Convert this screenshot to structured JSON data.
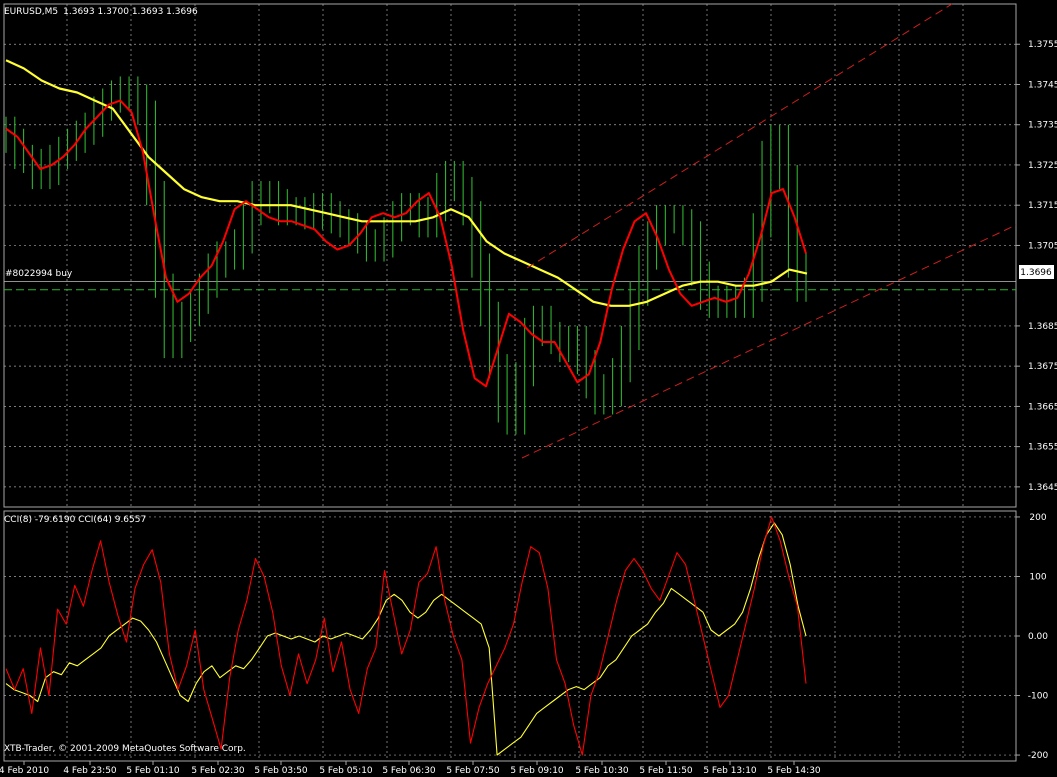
{
  "window_title": "EURUSD,M5",
  "ohlc": "1.3693 1.3700 1.3693 1.3696",
  "copyright": "XTB-Trader, © 2001-2009 MetaQuotes Software Corp.",
  "order": {
    "label": "#8022994 buy",
    "price": 1.3694
  },
  "current_price_label": "1.3696",
  "colors": {
    "background": "#000000",
    "grid": "#a6a6a6",
    "bars": "#2fb12f",
    "ma_fast": "#ff0000",
    "ma_slow": "#ffff33",
    "channel": "#cc1f1f",
    "order_line": "#29b929",
    "text": "#ffffff"
  },
  "chart_data": [
    {
      "type": "line",
      "title": "EURUSD,M5",
      "ylim": [
        1.364,
        1.3765
      ],
      "y_ticks": [
        "1.3755",
        "1.3745",
        "1.3735",
        "1.3725",
        "1.3715",
        "1.3705",
        "1.3685",
        "1.3675",
        "1.3665",
        "1.3655",
        "1.3645"
      ],
      "x_labels": [
        "4 Feb 2010",
        "4 Feb 23:50",
        "5 Feb 01:10",
        "5 Feb 02:30",
        "5 Feb 03:50",
        "5 Feb 05:10",
        "5 Feb 06:30",
        "5 Feb 07:50",
        "5 Feb 09:10",
        "5 Feb 10:30",
        "5 Feb 11:50",
        "5 Feb 13:10",
        "5 Feb 14:30"
      ],
      "grid": true,
      "series": [
        {
          "style": "bars",
          "values": [
            1.3734,
            1.3731,
            1.3727,
            1.3726,
            1.3722,
            1.3723,
            1.3727,
            1.3729,
            1.3731,
            1.3733,
            1.3735,
            1.3739,
            1.3741,
            1.3743,
            1.3744,
            1.3742,
            1.3738,
            1.3718,
            1.3695,
            1.368,
            1.3684,
            1.3688,
            1.3691,
            1.3695,
            1.37,
            1.3703,
            1.3702,
            1.3706,
            1.3713,
            1.3718,
            1.3718,
            1.3716,
            1.3713,
            1.3714,
            1.3713,
            1.3712,
            1.3715,
            1.3713,
            1.3711,
            1.371,
            1.3708,
            1.3706,
            1.3704,
            1.3705,
            1.3709,
            1.3713,
            1.3715,
            1.3713,
            1.371,
            1.3714,
            1.372,
            1.3723,
            1.3719,
            1.3713,
            1.37,
            1.3688,
            1.3675,
            1.3664,
            1.3661,
            1.3673,
            1.3684,
            1.3687,
            1.3683,
            1.3681,
            1.3679,
            1.3682,
            1.3676,
            1.367,
            1.3666,
            1.3668,
            1.3674,
            1.3682,
            1.3693,
            1.3702,
            1.3708,
            1.3712,
            1.3712,
            1.3711,
            1.3708,
            1.3698,
            1.3692,
            1.369,
            1.3692,
            1.3691,
            1.369,
            1.3694,
            1.371,
            1.3728,
            1.3732,
            1.3722,
            1.37,
            1.3694
          ]
        },
        {
          "name": "",
          "values": [
            1.3734,
            1.3732,
            1.3728,
            1.3724,
            1.3725,
            1.3727,
            1.373,
            1.3734,
            1.3737,
            1.374,
            1.3741,
            1.3738,
            1.3728,
            1.3712,
            1.3697,
            1.3691,
            1.3693,
            1.3697,
            1.37,
            1.3706,
            1.3714,
            1.3716,
            1.3714,
            1.3712,
            1.3711,
            1.3711,
            1.371,
            1.3709,
            1.3706,
            1.3704,
            1.3705,
            1.3708,
            1.3712,
            1.3713,
            1.3712,
            1.3713,
            1.3716,
            1.3718,
            1.3712,
            1.37,
            1.3684,
            1.3672,
            1.367,
            1.3679,
            1.3688,
            1.3686,
            1.3683,
            1.3681,
            1.3681,
            1.3676,
            1.3671,
            1.3673,
            1.3681,
            1.3694,
            1.3704,
            1.3711,
            1.3713,
            1.3707,
            1.3699,
            1.3693,
            1.369,
            1.3691,
            1.3692,
            1.3691,
            1.3692,
            1.3698,
            1.3707,
            1.3718,
            1.3719,
            1.3712,
            1.3703
          ]
        },
        {
          "name": "",
          "values": [
            1.3751,
            1.3749,
            1.3746,
            1.3744,
            1.3743,
            1.3741,
            1.3739,
            1.3733,
            1.3727,
            1.3723,
            1.3719,
            1.3717,
            1.3716,
            1.3716,
            1.3715,
            1.3715,
            1.3715,
            1.3714,
            1.3713,
            1.3712,
            1.3711,
            1.3711,
            1.3711,
            1.3711,
            1.3712,
            1.3714,
            1.3712,
            1.3706,
            1.3703,
            1.3701,
            1.3699,
            1.3697,
            1.3694,
            1.3691,
            1.369,
            1.369,
            1.3691,
            1.3693,
            1.3695,
            1.3696,
            1.3696,
            1.3695,
            1.3695,
            1.3696,
            1.3699,
            1.3698
          ]
        }
      ]
    },
    {
      "type": "line",
      "title": "CCI(8) -79.6190  CCI(64) 9.6557",
      "ylim": [
        -210,
        210
      ],
      "y_ticks": [
        "200",
        "100",
        "0.00",
        "-100",
        "-200"
      ],
      "grid": true,
      "series": [
        {
          "name": "CCI(8)",
          "values": [
            -55,
            -90,
            -55,
            -130,
            -20,
            -100,
            45,
            20,
            85,
            50,
            110,
            160,
            90,
            35,
            -10,
            80,
            120,
            145,
            90,
            -30,
            -90,
            -50,
            10,
            -90,
            -140,
            -190,
            -70,
            10,
            60,
            130,
            100,
            40,
            -50,
            -100,
            -30,
            -80,
            -40,
            30,
            -60,
            -10,
            -90,
            -130,
            -55,
            -20,
            110,
            40,
            -30,
            10,
            90,
            105,
            150,
            60,
            0,
            -40,
            -180,
            -120,
            -80,
            -50,
            -20,
            20,
            90,
            150,
            140,
            80,
            -40,
            -80,
            -150,
            -200,
            -100,
            -60,
            0,
            60,
            110,
            130,
            110,
            80,
            60,
            100,
            140,
            120,
            60,
            0,
            -60,
            -120,
            -100,
            -40,
            20,
            80,
            150,
            200,
            160,
            100,
            50,
            -80
          ]
        },
        {
          "name": "CCI(64)",
          "values": [
            -80,
            -90,
            -95,
            -100,
            -110,
            -70,
            -60,
            -65,
            -45,
            -50,
            -40,
            -30,
            -20,
            0,
            10,
            20,
            30,
            25,
            10,
            -10,
            -40,
            -70,
            -100,
            -110,
            -80,
            -60,
            -50,
            -70,
            -60,
            -50,
            -55,
            -40,
            -20,
            0,
            5,
            0,
            -5,
            0,
            -5,
            -10,
            0,
            -5,
            0,
            5,
            0,
            -5,
            10,
            30,
            60,
            70,
            60,
            40,
            30,
            40,
            60,
            70,
            60,
            50,
            40,
            30,
            20,
            -20,
            -200,
            -190,
            -180,
            -170,
            -150,
            -130,
            -120,
            -110,
            -100,
            -90,
            -85,
            -90,
            -80,
            -70,
            -50,
            -40,
            -20,
            0,
            10,
            20,
            40,
            55,
            80,
            70,
            60,
            50,
            40,
            10,
            0,
            10,
            20,
            40,
            80,
            130,
            170,
            190,
            170,
            120,
            50,
            0
          ]
        }
      ]
    }
  ]
}
